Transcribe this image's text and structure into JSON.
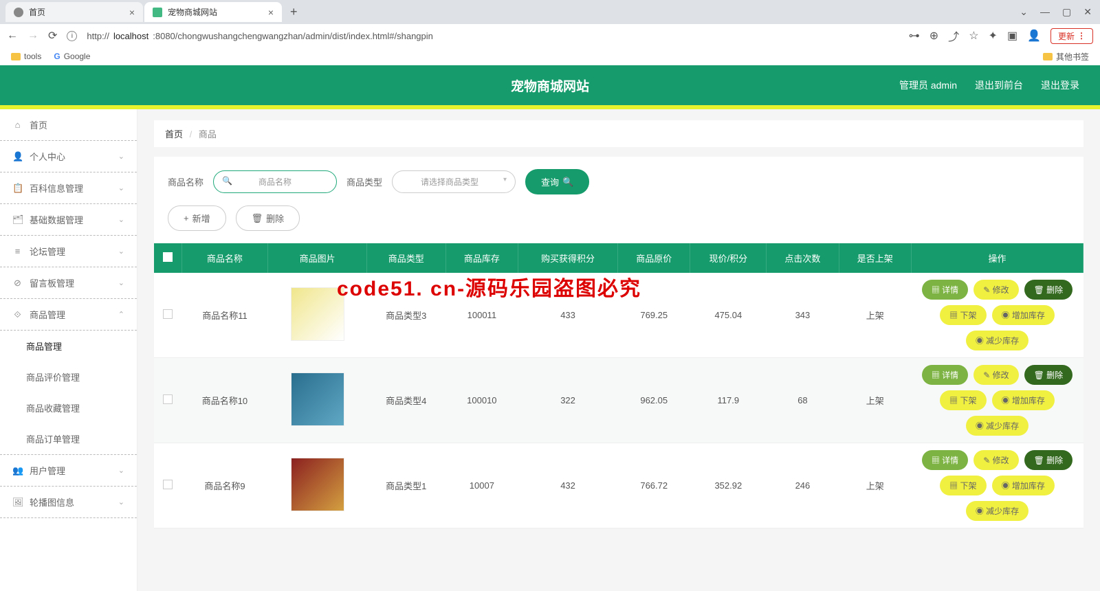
{
  "browser": {
    "tabs": [
      {
        "title": "首页",
        "active": false
      },
      {
        "title": "宠物商城网站",
        "active": true
      }
    ],
    "url_prefix": "http://",
    "url_host": "localhost",
    "url_path": ":8080/chongwushangchengwangzhan/admin/dist/index.html#/shangpin",
    "update_label": "更新",
    "bookmarks": {
      "tools": "tools",
      "google": "Google",
      "other": "其他书签"
    },
    "win": {
      "min": "—",
      "max": "▢",
      "close": "✕",
      "chev": "⌄"
    }
  },
  "header": {
    "title": "宠物商城网站",
    "admin_label": "管理员 admin",
    "to_front": "退出到前台",
    "logout": "退出登录"
  },
  "sidebar": {
    "home": "首页",
    "items": [
      {
        "icon": "👤",
        "label": "个人中心",
        "expandable": true
      },
      {
        "icon": "📋",
        "label": "百科信息管理",
        "expandable": true
      },
      {
        "icon": "🗂",
        "label": "基础数据管理",
        "expandable": true
      },
      {
        "icon": "≡",
        "label": "论坛管理",
        "expandable": true
      },
      {
        "icon": "⊘",
        "label": "留言板管理",
        "expandable": true
      },
      {
        "icon": "⟐",
        "label": "商品管理",
        "expandable": true,
        "expanded": true,
        "children": [
          {
            "label": "商品管理",
            "active": true
          },
          {
            "label": "商品评价管理"
          },
          {
            "label": "商品收藏管理"
          },
          {
            "label": "商品订单管理"
          }
        ]
      },
      {
        "icon": "👥",
        "label": "用户管理",
        "expandable": true
      },
      {
        "icon": "🖼",
        "label": "轮播图信息",
        "expandable": true
      }
    ]
  },
  "breadcrumb": {
    "home": "首页",
    "current": "商品"
  },
  "filters": {
    "name_label": "商品名称",
    "name_placeholder": "商品名称",
    "type_label": "商品类型",
    "type_placeholder": "请选择商品类型",
    "search_btn": "查询",
    "add_btn": "新增",
    "delete_btn": "删除"
  },
  "table": {
    "headers": [
      "",
      "商品名称",
      "商品图片",
      "商品类型",
      "商品库存",
      "购买获得积分",
      "商品原价",
      "现价/积分",
      "点击次数",
      "是否上架",
      "操作"
    ],
    "rows": [
      {
        "name": "商品名称11",
        "type": "商品类型3",
        "stock": "100011",
        "points": "433",
        "orig": "769.25",
        "now": "475.04",
        "clicks": "343",
        "on_shelf": "上架"
      },
      {
        "name": "商品名称10",
        "type": "商品类型4",
        "stock": "100010",
        "points": "322",
        "orig": "962.05",
        "now": "117.9",
        "clicks": "68",
        "on_shelf": "上架"
      },
      {
        "name": "商品名称9",
        "type": "商品类型1",
        "stock": "10007",
        "points": "432",
        "orig": "766.72",
        "now": "352.92",
        "clicks": "246",
        "on_shelf": "上架"
      }
    ],
    "actions": {
      "detail": "详情",
      "edit": "修改",
      "delete": "删除",
      "off_shelf": "下架",
      "add_stock": "增加库存",
      "reduce_stock": "减少库存"
    }
  },
  "watermarks": {
    "text": "code51.cn",
    "red": "code51. cn-源码乐园盗图必究"
  }
}
